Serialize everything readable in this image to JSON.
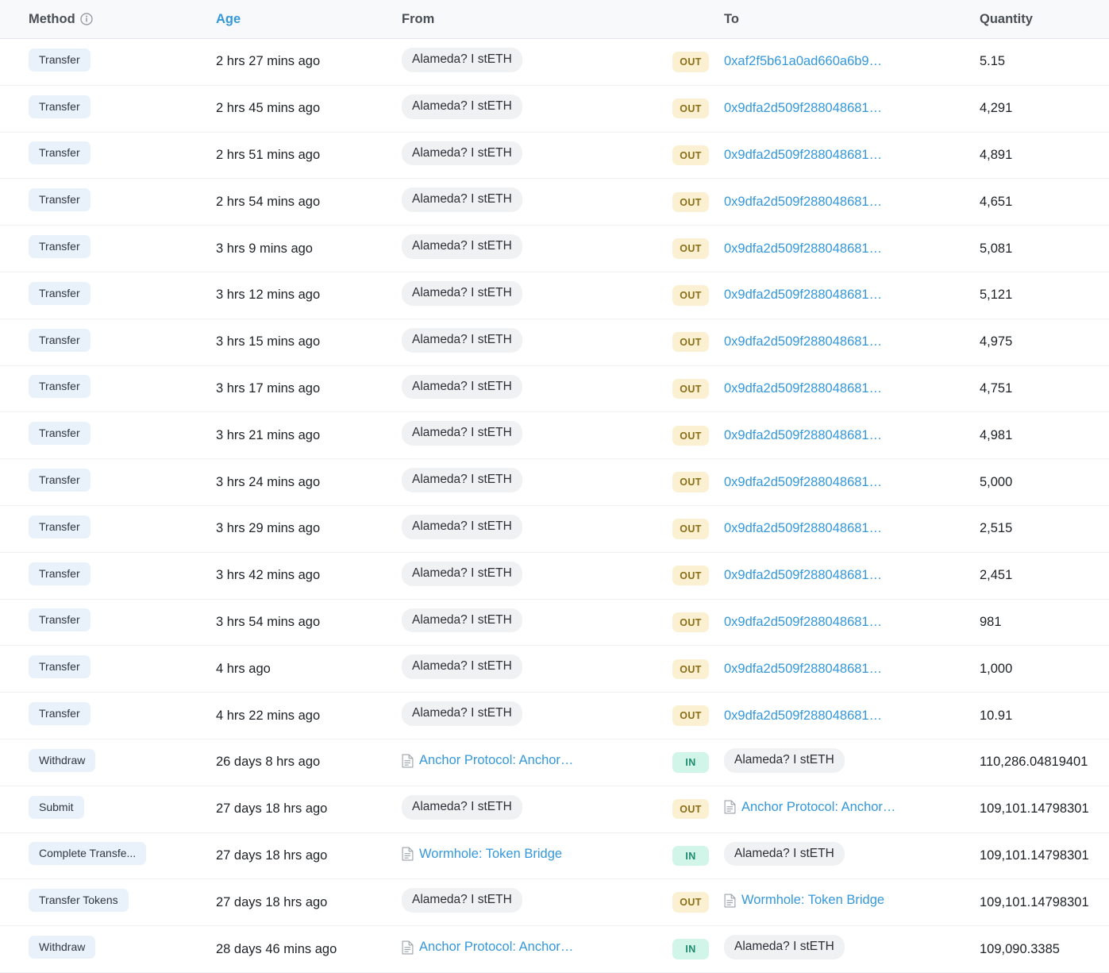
{
  "table": {
    "columns": {
      "method": "Method",
      "age": "Age",
      "from": "From",
      "to": "To",
      "quantity": "Quantity"
    },
    "method_info_icon": "info-icon",
    "colors": {
      "link": "#3498db",
      "header_sorted": "#3498db",
      "method_badge_bg": "#e9f2fb",
      "out_badge_bg": "#fbf1d2",
      "out_badge_text": "#8a6d17",
      "in_badge_bg": "#d2f5ea",
      "in_badge_text": "#1d8a6e",
      "entity_pill_bg": "#f0f1f2",
      "header_bg": "#f8f9fb"
    },
    "rows": [
      {
        "method": "Transfer",
        "age": "2 hrs 27 mins ago",
        "from": {
          "text": "Alameda? I stETH",
          "type": "pill"
        },
        "direction": "OUT",
        "to": {
          "text": "0xaf2f5b61a0ad660a6b9…",
          "type": "link"
        },
        "quantity": "5.15"
      },
      {
        "method": "Transfer",
        "age": "2 hrs 45 mins ago",
        "from": {
          "text": "Alameda? I stETH",
          "type": "pill"
        },
        "direction": "OUT",
        "to": {
          "text": "0x9dfa2d509f288048681…",
          "type": "link"
        },
        "quantity": "4,291"
      },
      {
        "method": "Transfer",
        "age": "2 hrs 51 mins ago",
        "from": {
          "text": "Alameda? I stETH",
          "type": "pill"
        },
        "direction": "OUT",
        "to": {
          "text": "0x9dfa2d509f288048681…",
          "type": "link"
        },
        "quantity": "4,891"
      },
      {
        "method": "Transfer",
        "age": "2 hrs 54 mins ago",
        "from": {
          "text": "Alameda? I stETH",
          "type": "pill"
        },
        "direction": "OUT",
        "to": {
          "text": "0x9dfa2d509f288048681…",
          "type": "link"
        },
        "quantity": "4,651"
      },
      {
        "method": "Transfer",
        "age": "3 hrs 9 mins ago",
        "from": {
          "text": "Alameda? I stETH",
          "type": "pill"
        },
        "direction": "OUT",
        "to": {
          "text": "0x9dfa2d509f288048681…",
          "type": "link"
        },
        "quantity": "5,081"
      },
      {
        "method": "Transfer",
        "age": "3 hrs 12 mins ago",
        "from": {
          "text": "Alameda? I stETH",
          "type": "pill"
        },
        "direction": "OUT",
        "to": {
          "text": "0x9dfa2d509f288048681…",
          "type": "link"
        },
        "quantity": "5,121"
      },
      {
        "method": "Transfer",
        "age": "3 hrs 15 mins ago",
        "from": {
          "text": "Alameda? I stETH",
          "type": "pill"
        },
        "direction": "OUT",
        "to": {
          "text": "0x9dfa2d509f288048681…",
          "type": "link"
        },
        "quantity": "4,975"
      },
      {
        "method": "Transfer",
        "age": "3 hrs 17 mins ago",
        "from": {
          "text": "Alameda? I stETH",
          "type": "pill"
        },
        "direction": "OUT",
        "to": {
          "text": "0x9dfa2d509f288048681…",
          "type": "link"
        },
        "quantity": "4,751"
      },
      {
        "method": "Transfer",
        "age": "3 hrs 21 mins ago",
        "from": {
          "text": "Alameda? I stETH",
          "type": "pill"
        },
        "direction": "OUT",
        "to": {
          "text": "0x9dfa2d509f288048681…",
          "type": "link"
        },
        "quantity": "4,981"
      },
      {
        "method": "Transfer",
        "age": "3 hrs 24 mins ago",
        "from": {
          "text": "Alameda? I stETH",
          "type": "pill"
        },
        "direction": "OUT",
        "to": {
          "text": "0x9dfa2d509f288048681…",
          "type": "link"
        },
        "quantity": "5,000"
      },
      {
        "method": "Transfer",
        "age": "3 hrs 29 mins ago",
        "from": {
          "text": "Alameda? I stETH",
          "type": "pill"
        },
        "direction": "OUT",
        "to": {
          "text": "0x9dfa2d509f288048681…",
          "type": "link"
        },
        "quantity": "2,515"
      },
      {
        "method": "Transfer",
        "age": "3 hrs 42 mins ago",
        "from": {
          "text": "Alameda? I stETH",
          "type": "pill"
        },
        "direction": "OUT",
        "to": {
          "text": "0x9dfa2d509f288048681…",
          "type": "link"
        },
        "quantity": "2,451"
      },
      {
        "method": "Transfer",
        "age": "3 hrs 54 mins ago",
        "from": {
          "text": "Alameda? I stETH",
          "type": "pill"
        },
        "direction": "OUT",
        "to": {
          "text": "0x9dfa2d509f288048681…",
          "type": "link"
        },
        "quantity": "981"
      },
      {
        "method": "Transfer",
        "age": "4 hrs ago",
        "from": {
          "text": "Alameda? I stETH",
          "type": "pill"
        },
        "direction": "OUT",
        "to": {
          "text": "0x9dfa2d509f288048681…",
          "type": "link"
        },
        "quantity": "1,000"
      },
      {
        "method": "Transfer",
        "age": "4 hrs 22 mins ago",
        "from": {
          "text": "Alameda? I stETH",
          "type": "pill"
        },
        "direction": "OUT",
        "to": {
          "text": "0x9dfa2d509f288048681…",
          "type": "link"
        },
        "quantity": "10.91"
      },
      {
        "method": "Withdraw",
        "age": "26 days 8 hrs ago",
        "from": {
          "text": "Anchor Protocol: Anchor…",
          "type": "contract"
        },
        "direction": "IN",
        "to": {
          "text": "Alameda? I stETH",
          "type": "pill"
        },
        "quantity": "110,286.04819401"
      },
      {
        "method": "Submit",
        "age": "27 days 18 hrs ago",
        "from": {
          "text": "Alameda? I stETH",
          "type": "pill"
        },
        "direction": "OUT",
        "to": {
          "text": "Anchor Protocol: Anchor…",
          "type": "contract"
        },
        "quantity": "109,101.14798301"
      },
      {
        "method": "Complete Transfe...",
        "age": "27 days 18 hrs ago",
        "from": {
          "text": "Wormhole: Token Bridge",
          "type": "contract"
        },
        "direction": "IN",
        "to": {
          "text": "Alameda? I stETH",
          "type": "pill"
        },
        "quantity": "109,101.14798301"
      },
      {
        "method": "Transfer Tokens",
        "age": "27 days 18 hrs ago",
        "from": {
          "text": "Alameda? I stETH",
          "type": "pill"
        },
        "direction": "OUT",
        "to": {
          "text": "Wormhole: Token Bridge",
          "type": "contract"
        },
        "quantity": "109,101.14798301"
      },
      {
        "method": "Withdraw",
        "age": "28 days 46 mins ago",
        "from": {
          "text": "Anchor Protocol: Anchor…",
          "type": "contract"
        },
        "direction": "IN",
        "to": {
          "text": "Alameda? I stETH",
          "type": "pill"
        },
        "quantity": "109,090.3385"
      }
    ]
  }
}
